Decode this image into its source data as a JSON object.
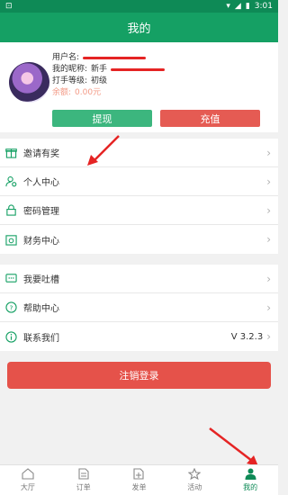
{
  "status_bar": {
    "time": "3:01"
  },
  "header": {
    "title": "我的"
  },
  "profile": {
    "username_label": "用户名:",
    "nickname_label": "我的昵称:",
    "nickname_value": "新手",
    "level_label": "打手等级:",
    "level_value": "初级",
    "balance_label": "余额:",
    "balance_value": "0.00元",
    "withdraw_button": "提现",
    "recharge_button": "充值"
  },
  "menu_group_1": [
    {
      "label": "邀请有奖",
      "icon": "gift-icon"
    },
    {
      "label": "个人中心",
      "icon": "user-settings-icon"
    },
    {
      "label": "密码管理",
      "icon": "lock-icon"
    },
    {
      "label": "财务中心",
      "icon": "finance-icon"
    }
  ],
  "menu_group_2": [
    {
      "label": "我要吐槽",
      "icon": "chat-icon"
    },
    {
      "label": "帮助中心",
      "icon": "help-icon"
    },
    {
      "label": "联系我们",
      "icon": "info-icon",
      "value": "V 3.2.3"
    }
  ],
  "logout_button": "注销登录",
  "tabs": [
    {
      "label": "大厅",
      "icon": "home-icon"
    },
    {
      "label": "订单",
      "icon": "document-icon"
    },
    {
      "label": "发单",
      "icon": "publish-icon"
    },
    {
      "label": "活动",
      "icon": "star-icon"
    },
    {
      "label": "我的",
      "icon": "person-icon",
      "active": true
    }
  ],
  "colors": {
    "primary": "#15a064",
    "status_bar": "#0e8a56",
    "danger": "#e5524a",
    "green_button": "#3cb67e"
  }
}
